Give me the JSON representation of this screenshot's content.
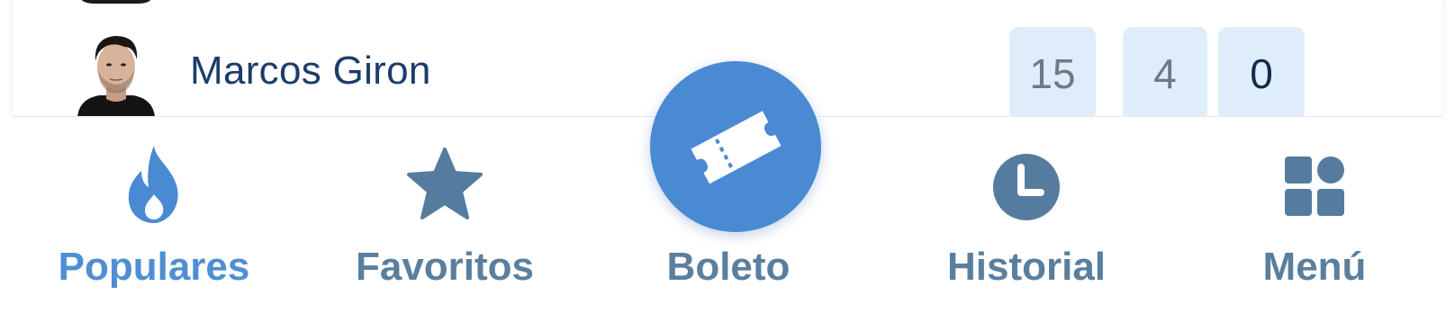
{
  "list": {
    "rows": [
      {
        "name": "Marcos Giron",
        "stats": [
          "15",
          "4",
          "0"
        ]
      }
    ]
  },
  "nav": {
    "items": [
      {
        "label": "Populares",
        "icon": "flame-icon",
        "active": true
      },
      {
        "label": "Favoritos",
        "icon": "star-icon",
        "active": false
      },
      {
        "label": "Boleto",
        "icon": "ticket-icon",
        "active": false
      },
      {
        "label": "Historial",
        "icon": "clock-icon",
        "active": false
      },
      {
        "label": "Menú",
        "icon": "grid-icon",
        "active": false
      }
    ]
  },
  "colors": {
    "accent": "#4a8ad3",
    "active_label": "#4e8fd3",
    "inactive_icon": "#557c9e",
    "stat_bg": "#deedf9",
    "name_text": "#1c3d6b"
  }
}
